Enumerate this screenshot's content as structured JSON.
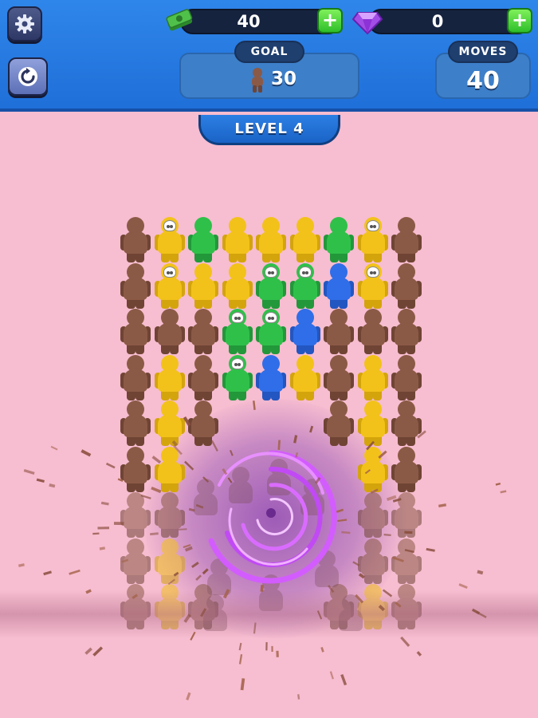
{
  "hud": {
    "cash": {
      "value": "40",
      "icon": "cash-stack-icon",
      "add_icon": "plus-icon"
    },
    "gems": {
      "value": "0",
      "icon": "purple-gem-icon",
      "add_icon": "plus-icon"
    },
    "goal": {
      "label": "GOAL",
      "value": "30",
      "icon": "brown-figure-icon"
    },
    "moves": {
      "label": "MOVES",
      "value": "40"
    },
    "settings_icon": "gear-icon",
    "restart_icon": "restart-icon"
  },
  "level": {
    "label": "LEVEL 4"
  },
  "colors": {
    "brown": "#8b5a46",
    "yellow": "#f2c21a",
    "green": "#2fc04a",
    "blue": "#2f6ee8",
    "vortex": "#b43cff",
    "background": "#f7bdd0"
  },
  "board": {
    "columns": 9,
    "grid": [
      [
        "brown",
        "yellow-skull",
        "green",
        "yellow",
        "yellow",
        "yellow",
        "green",
        "yellow-skull",
        "brown"
      ],
      [
        "brown",
        "yellow-skull",
        "yellow",
        "yellow",
        "green-skull",
        "green-skull",
        "blue",
        "yellow-skull",
        "brown"
      ],
      [
        "brown",
        "brown",
        "brown",
        "green-skull",
        "green-skull",
        "blue",
        "brown",
        "brown",
        "brown"
      ],
      [
        "brown",
        "yellow",
        "brown",
        "green-skull",
        "blue",
        "yellow",
        "brown",
        "yellow",
        "brown"
      ],
      [
        "brown",
        "yellow",
        "brown",
        "",
        "",
        "",
        "brown",
        "yellow",
        "brown"
      ],
      [
        "brown",
        "yellow",
        "",
        "",
        "",
        "",
        "",
        "yellow",
        "brown"
      ],
      [
        "brown",
        "brown",
        "",
        "",
        "",
        "",
        "",
        "brown",
        "brown"
      ],
      [
        "brown",
        "yellow",
        "",
        "",
        "",
        "",
        "",
        "brown",
        "brown"
      ],
      [
        "brown",
        "yellow",
        "brown",
        "",
        "",
        "",
        "brown",
        "yellow",
        "brown"
      ]
    ]
  }
}
